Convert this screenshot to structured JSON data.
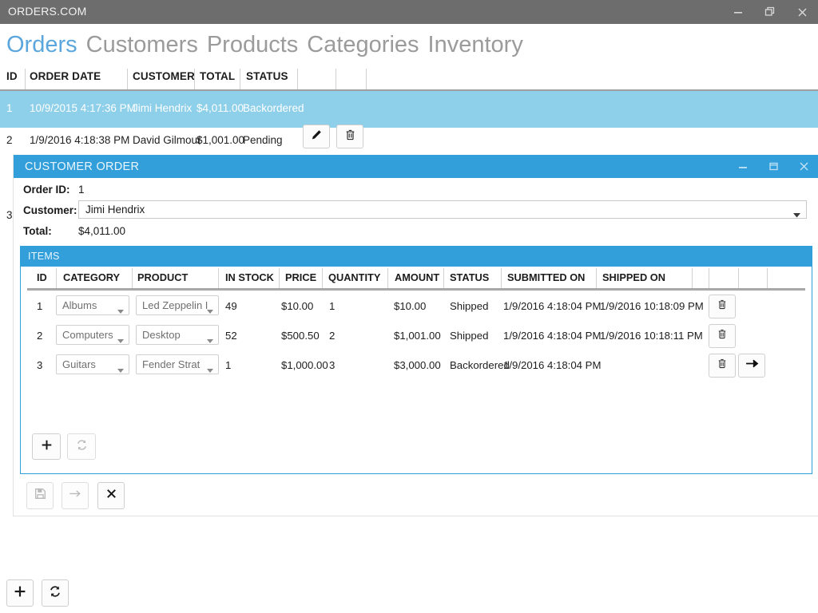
{
  "window": {
    "title": "ORDERS.COM",
    "controls": [
      {
        "name": "minimize-button",
        "icon": "minimize-icon"
      },
      {
        "name": "maximize-button",
        "icon": "maximize-icon"
      },
      {
        "name": "close-button",
        "icon": "close-icon"
      }
    ],
    "titlebar_color": "#6d6d6d"
  },
  "nav": {
    "items": [
      {
        "label": "Orders",
        "active": true
      },
      {
        "label": "Customers",
        "active": false
      },
      {
        "label": "Products",
        "active": false
      },
      {
        "label": "Categories",
        "active": false
      },
      {
        "label": "Inventory",
        "active": false
      }
    ],
    "active_color": "#5ba6dd",
    "inactive_color": "#9b9b9b"
  },
  "orders_grid": {
    "columns": [
      "ID",
      "ORDER DATE",
      "CUSTOMER",
      "TOTAL",
      "STATUS",
      "",
      "",
      ""
    ],
    "selected_row_color": "#8ecfe9",
    "rows": [
      {
        "id": "1",
        "order_date": "10/9/2015 4:17:36 PM",
        "customer": "Jimi Hendrix",
        "total": "$4,011.00",
        "status": "Backordered",
        "selected": true,
        "buttons": [
          "edit-icon"
        ]
      },
      {
        "id": "2",
        "order_date": "1/9/2016 4:18:38 PM",
        "customer": "David Gilmour",
        "total": "$1,001.00",
        "status": "Pending",
        "selected": false,
        "buttons": [
          "edit-icon",
          "trash-icon"
        ]
      },
      {
        "id": "3",
        "order_date": "",
        "customer": "",
        "total": "",
        "status": "",
        "selected": false,
        "buttons": []
      }
    ]
  },
  "dialog": {
    "title": "CUSTOMER ORDER",
    "title_color": "#339fda",
    "controls": [
      {
        "name": "dialog-minimize-button",
        "icon": "minimize-icon"
      },
      {
        "name": "dialog-maximize-button",
        "icon": "maximize-icon"
      },
      {
        "name": "dialog-close-button",
        "icon": "close-icon"
      }
    ],
    "fields": {
      "order_id_label": "Order ID:",
      "order_id_value": "1",
      "customer_label": "Customer:",
      "customer_value": "Jimi Hendrix",
      "total_label": "Total:",
      "total_value": "$4,011.00"
    },
    "items_panel": {
      "title": "ITEMS",
      "columns": [
        "ID",
        "CATEGORY",
        "PRODUCT",
        "IN STOCK",
        "PRICE",
        "QUANTITY",
        "AMOUNT",
        "STATUS",
        "SUBMITTED ON",
        "SHIPPED ON",
        "",
        "",
        "",
        ""
      ],
      "rows": [
        {
          "id": "1",
          "category": "Albums",
          "product": "Led Zeppelin I",
          "in_stock": "49",
          "price": "$10.00",
          "quantity": "1",
          "amount": "$10.00",
          "status": "Shipped",
          "submitted_on": "1/9/2016 4:18:04 PM",
          "shipped_on": "1/9/2016 10:18:09 PM",
          "buttons": [
            "trash-icon"
          ]
        },
        {
          "id": "2",
          "category": "Computers",
          "product": "Desktop",
          "in_stock": "52",
          "price": "$500.50",
          "quantity": "2",
          "amount": "$1,001.00",
          "status": "Shipped",
          "submitted_on": "1/9/2016 4:18:04 PM",
          "shipped_on": "1/9/2016 10:18:11 PM",
          "buttons": [
            "trash-icon"
          ]
        },
        {
          "id": "3",
          "category": "Guitars",
          "product": "Fender Strat",
          "in_stock": "1",
          "price": "$1,000.00",
          "quantity": "3",
          "amount": "$3,000.00",
          "status": "Backordered",
          "submitted_on": "1/9/2016 4:18:04 PM",
          "shipped_on": "",
          "buttons": [
            "trash-icon",
            "arrow-right-icon"
          ]
        }
      ],
      "toolbar": [
        {
          "name": "add-item-button",
          "icon": "plus-icon",
          "enabled": true
        },
        {
          "name": "refresh-items-button",
          "icon": "refresh-icon",
          "enabled": false
        }
      ]
    },
    "footer": [
      {
        "name": "save-order-button",
        "icon": "save-icon",
        "enabled": false
      },
      {
        "name": "submit-order-button",
        "icon": "arrow-right-icon",
        "enabled": false
      },
      {
        "name": "cancel-order-button",
        "icon": "close-x-icon",
        "enabled": true
      }
    ]
  },
  "page_toolbar": [
    {
      "name": "add-order-button",
      "icon": "plus-icon",
      "enabled": true
    },
    {
      "name": "refresh-orders-button",
      "icon": "refresh-icon",
      "enabled": true
    }
  ]
}
